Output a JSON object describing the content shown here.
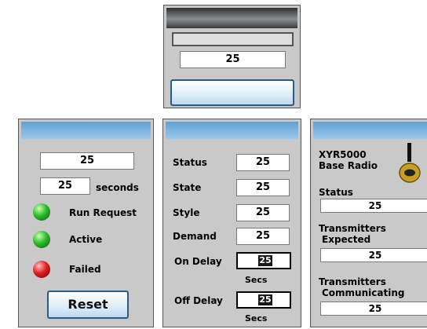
{
  "top_panel": {
    "value": "25"
  },
  "left_panel": {
    "value": "25",
    "seconds_value": "25",
    "seconds_label": "seconds",
    "indicators": [
      {
        "label": "Run Request",
        "color": "#2dbb2a"
      },
      {
        "label": "Active",
        "color": "#2dbb2a"
      },
      {
        "label": "Failed",
        "color": "#e02020"
      }
    ],
    "reset_label": "Reset"
  },
  "middle_panel": {
    "rows": [
      {
        "label": "Status",
        "value": "25"
      },
      {
        "label": "State",
        "value": "25"
      },
      {
        "label": "Style",
        "value": "25"
      },
      {
        "label": "Demand",
        "value": "25"
      }
    ],
    "on_delay": {
      "label": "On Delay",
      "value": "25",
      "unit": "Secs"
    },
    "off_delay": {
      "label": "Off Delay",
      "value": "25",
      "unit": "Secs"
    }
  },
  "right_panel": {
    "device_line1": "XYR5000",
    "device_line2": "Base Radio",
    "status_label": "Status",
    "status_value": "25",
    "expected_label1": "Transmitters",
    "expected_label2": "Expected",
    "expected_value": "25",
    "communicating_label1": "Transmitters",
    "communicating_label2": "Communicating",
    "communicating_value": "25"
  }
}
